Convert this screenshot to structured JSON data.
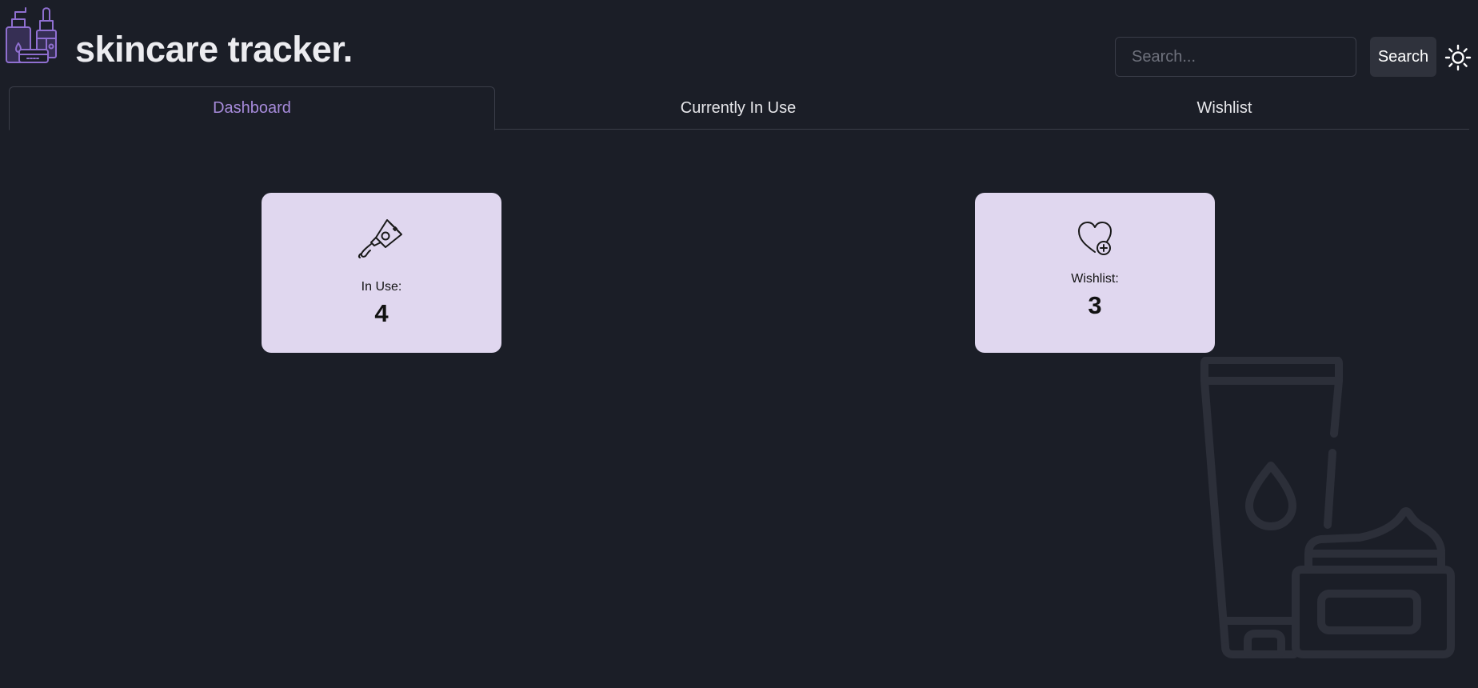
{
  "app": {
    "title": "skincare tracker."
  },
  "search": {
    "placeholder": "Search...",
    "value": "",
    "button_label": "Search"
  },
  "theme_toggle": {
    "icon": "sun-icon"
  },
  "tabs": [
    {
      "label": "Dashboard",
      "active": true
    },
    {
      "label": "Currently In Use",
      "active": false
    },
    {
      "label": "Wishlist",
      "active": false
    }
  ],
  "cards": {
    "in_use": {
      "icon": "cream-tube-icon",
      "label": "In Use:",
      "value": "4"
    },
    "wishlist": {
      "icon": "heart-plus-icon",
      "label": "Wishlist:",
      "value": "3"
    }
  },
  "colors": {
    "background": "#1b1e27",
    "accent": "#a78bdb",
    "card_background": "#e0d7ef",
    "tab_border": "#3b3e49",
    "button_background": "#2f323c"
  }
}
